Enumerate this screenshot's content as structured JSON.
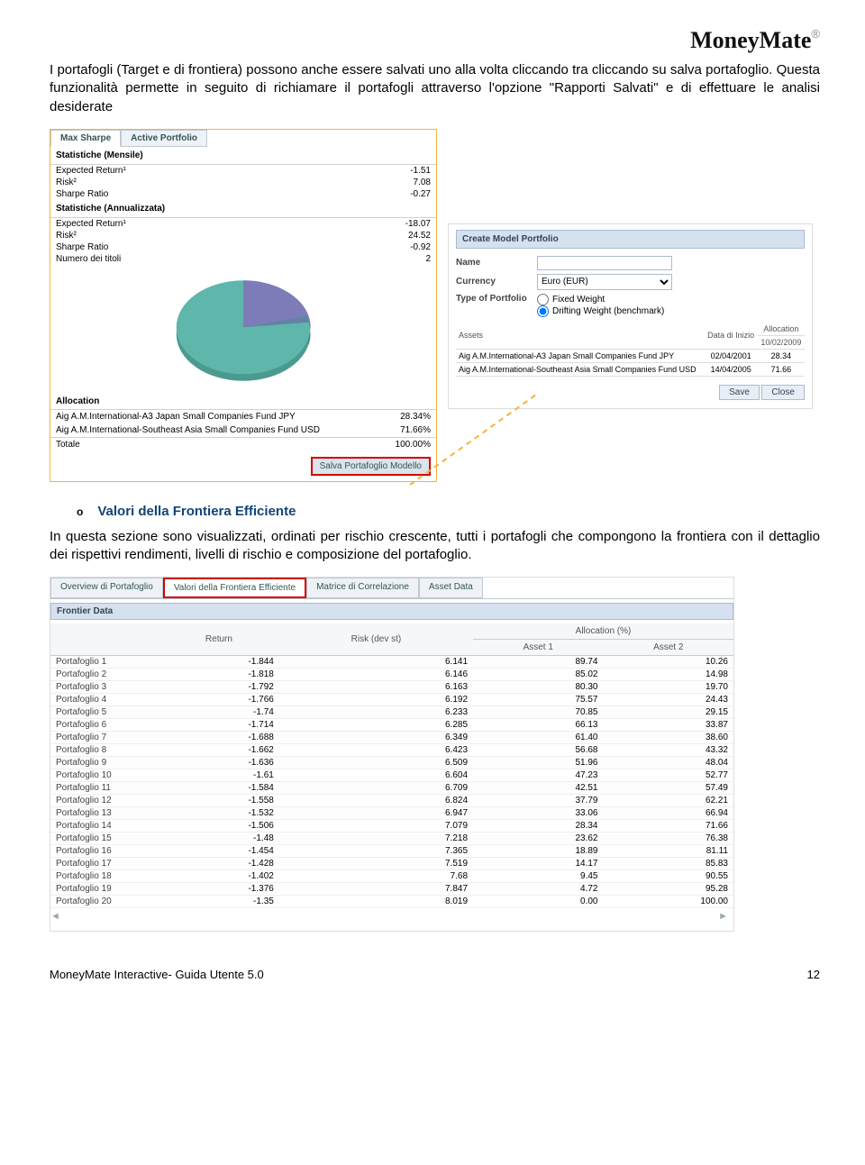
{
  "brand": {
    "name": "MoneyMate",
    "mark": "®"
  },
  "para1": "I portafogli (Target e di frontiera) possono anche essere salvati uno alla volta cliccando tra cliccando su salva portafoglio. Questa funzionalità permette in seguito di richiamare il portafogli attraverso l'opzione \"Rapporti Salvati\" e di effettuare le analisi desiderate",
  "left": {
    "tabs": [
      "Max Sharpe",
      "Active Portfolio"
    ],
    "sec1": "Statistiche (Mensile)",
    "m_rows": [
      {
        "l": "Expected Return¹",
        "v": "-1.51"
      },
      {
        "l": "Risk²",
        "v": "7.08"
      },
      {
        "l": "Sharpe Ratio",
        "v": "-0.27"
      }
    ],
    "sec2": "Statistiche (Annualizzata)",
    "a_rows": [
      {
        "l": "Expected Return¹",
        "v": "-18.07"
      },
      {
        "l": "Risk²",
        "v": "24.52"
      },
      {
        "l": "Sharpe Ratio",
        "v": "-0.92"
      },
      {
        "l": "Numero dei titoli",
        "v": "2"
      }
    ],
    "alloc_head": "Allocation",
    "alloc_rows": [
      {
        "l": "Aig A.M.International-A3 Japan Small Companies Fund JPY",
        "v": "28.34%"
      },
      {
        "l": "Aig A.M.International-Southeast Asia Small Companies Fund USD",
        "v": "71.66%"
      },
      {
        "l": "Totale",
        "v": "100.00%"
      }
    ],
    "save_btn": "Salva Portafoglio Modello"
  },
  "dialog": {
    "title": "Create Model Portfolio",
    "name_lbl": "Name",
    "curr_lbl": "Currency",
    "curr_val": "Euro (EUR)",
    "type_lbl": "Type of Portfolio",
    "r1": "Fixed Weight",
    "r2": "Drifting Weight (benchmark)",
    "th_assets": "Assets",
    "th_date": "Data di Inizio",
    "th_alloc": "Allocation",
    "alloc_date": "10/02/2009",
    "rows": [
      {
        "a": "Aig A.M.International-A3 Japan Small Companies Fund JPY",
        "d": "02/04/2001",
        "v": "28.34"
      },
      {
        "a": "Aig A.M.International-Southeast Asia Small Companies Fund USD",
        "d": "14/04/2005",
        "v": "71.66"
      }
    ],
    "save": "Save",
    "close": "Close"
  },
  "subhead": "Valori della Frontiera Efficiente",
  "para2": "In questa sezione sono visualizzati, ordinati per rischio crescente, tutti i portafogli che compongono la frontiera con il dettaglio dei rispettivi rendimenti, livelli di rischio e composizione del portafoglio.",
  "ftabs": [
    "Overview di Portafoglio",
    "Valori della Frontiera Efficiente",
    "Matrice di Correlazione",
    "Asset Data"
  ],
  "ft_title": "Frontier Data",
  "ft_cols": {
    "c0": "",
    "c1": "Return",
    "c2": "Risk (dev st)",
    "c3_top": "Allocation (%)",
    "c3a": "Asset 1",
    "c3b": "Asset 2"
  },
  "ft_rows": [
    {
      "n": "Portafoglio 1",
      "r": "-1.844",
      "k": "6.141",
      "a1": "89.74",
      "a2": "10.26"
    },
    {
      "n": "Portafoglio 2",
      "r": "-1.818",
      "k": "6.146",
      "a1": "85.02",
      "a2": "14.98"
    },
    {
      "n": "Portafoglio 3",
      "r": "-1.792",
      "k": "6.163",
      "a1": "80.30",
      "a2": "19.70"
    },
    {
      "n": "Portafoglio 4",
      "r": "-1.766",
      "k": "6.192",
      "a1": "75.57",
      "a2": "24.43"
    },
    {
      "n": "Portafoglio 5",
      "r": "-1.74",
      "k": "6.233",
      "a1": "70.85",
      "a2": "29.15"
    },
    {
      "n": "Portafoglio 6",
      "r": "-1.714",
      "k": "6.285",
      "a1": "66.13",
      "a2": "33.87"
    },
    {
      "n": "Portafoglio 7",
      "r": "-1.688",
      "k": "6.349",
      "a1": "61.40",
      "a2": "38.60"
    },
    {
      "n": "Portafoglio 8",
      "r": "-1.662",
      "k": "6.423",
      "a1": "56.68",
      "a2": "43.32"
    },
    {
      "n": "Portafoglio 9",
      "r": "-1.636",
      "k": "6.509",
      "a1": "51.96",
      "a2": "48.04"
    },
    {
      "n": "Portafoglio 10",
      "r": "-1.61",
      "k": "6.604",
      "a1": "47.23",
      "a2": "52.77"
    },
    {
      "n": "Portafoglio 11",
      "r": "-1.584",
      "k": "6.709",
      "a1": "42.51",
      "a2": "57.49"
    },
    {
      "n": "Portafoglio 12",
      "r": "-1.558",
      "k": "6.824",
      "a1": "37.79",
      "a2": "62.21"
    },
    {
      "n": "Portafoglio 13",
      "r": "-1.532",
      "k": "6.947",
      "a1": "33.06",
      "a2": "66.94"
    },
    {
      "n": "Portafoglio 14",
      "r": "-1.506",
      "k": "7.079",
      "a1": "28.34",
      "a2": "71.66"
    },
    {
      "n": "Portafoglio 15",
      "r": "-1.48",
      "k": "7.218",
      "a1": "23.62",
      "a2": "76.38"
    },
    {
      "n": "Portafoglio 16",
      "r": "-1.454",
      "k": "7.365",
      "a1": "18.89",
      "a2": "81.11"
    },
    {
      "n": "Portafoglio 17",
      "r": "-1.428",
      "k": "7.519",
      "a1": "14.17",
      "a2": "85.83"
    },
    {
      "n": "Portafoglio 18",
      "r": "-1.402",
      "k": "7.68",
      "a1": "9.45",
      "a2": "90.55"
    },
    {
      "n": "Portafoglio 19",
      "r": "-1.376",
      "k": "7.847",
      "a1": "4.72",
      "a2": "95.28"
    },
    {
      "n": "Portafoglio 20",
      "r": "-1.35",
      "k": "8.019",
      "a1": "0.00",
      "a2": "100.00"
    }
  ],
  "chart_data": {
    "type": "pie",
    "title": "Allocation",
    "series": [
      {
        "name": "Aig A.M.International-A3 Japan Small Companies Fund JPY",
        "value": 28.34,
        "color": "#7e7cb8"
      },
      {
        "name": "Aig A.M.International-Southeast Asia Small Companies Fund USD",
        "value": 71.66,
        "color": "#5fb6ab"
      }
    ]
  },
  "footer": {
    "left": "MoneyMate Interactive- Guida Utente 5.0",
    "right": "12"
  }
}
